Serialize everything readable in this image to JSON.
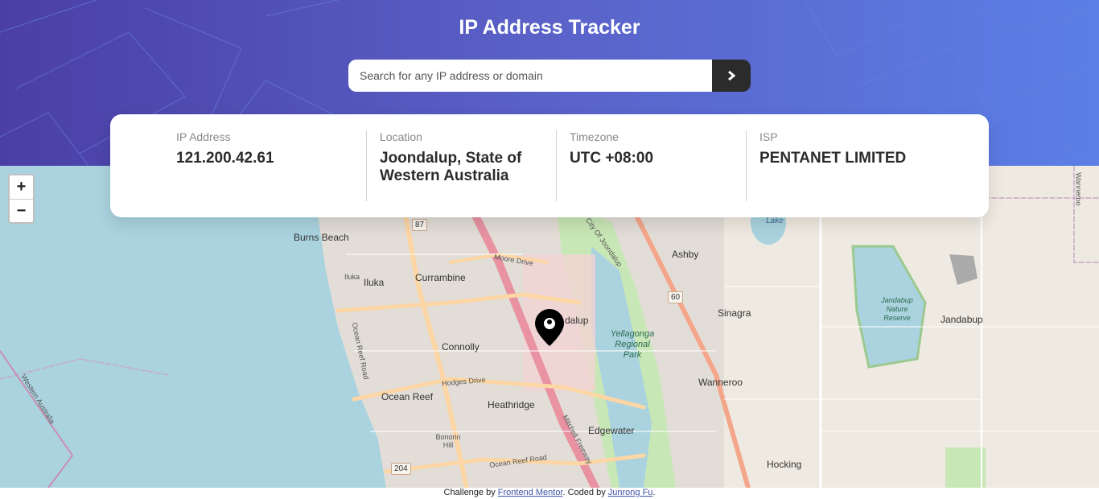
{
  "header": {
    "title": "IP Address Tracker",
    "search_placeholder": "Search for any IP address or domain"
  },
  "info": [
    {
      "label": "IP Address",
      "value": "121.200.42.61"
    },
    {
      "label": "Location",
      "value": "Joondalup, State of Western Australia"
    },
    {
      "label": "Timezone",
      "value": "UTC +08:00"
    },
    {
      "label": "ISP",
      "value": "PENTANET LIMITED"
    }
  ],
  "map": {
    "zoom_in": "+",
    "zoom_out": "−",
    "labels": {
      "burns_beach": "Burns Beach",
      "iluka": "Iluka",
      "iluka_small": "Iluka",
      "currambine": "Currambine",
      "connolly": "Connolly",
      "ocean_reef": "Ocean Reef",
      "heathridge": "Heathridge",
      "edgewater": "Edgewater",
      "joondalup": "dalup",
      "ashby": "Ashby",
      "sinagra": "Sinagra",
      "wanneroo": "Wanneroo",
      "jandabup": "Jandabup",
      "hocking": "Hocking",
      "lake": "Lake",
      "yellagonga": "Yellagonga Regional Park",
      "jandabup_reserve": "Jandabup Nature Reserve",
      "moore_drive": "Moore Drive",
      "hodges_drive": "Hodges Drive",
      "ocean_reef_road": "Ocean Reef Road",
      "ocean_reef_road2": "Ocean Reef Road",
      "mitchell_freeway": "Mitchell Freeway",
      "city_of_joondalup": "City Of Joondalup",
      "western_australia": "Western Australia",
      "wanneroo_edge": "Wanneroo",
      "bonorin_hill": "Bonorin Hill"
    },
    "shields": {
      "r87": "87",
      "r60": "60",
      "r204": "204"
    }
  },
  "footer": {
    "prefix": "Challenge by ",
    "fm_link": "Frontend Mentor",
    "middle": ". Coded by ",
    "author_link": "Junrong Fu",
    "suffix": "."
  },
  "colors": {
    "gradient_start": "#4a3fa5",
    "gradient_end": "#5b7fe6",
    "button": "#2b2b2b"
  }
}
